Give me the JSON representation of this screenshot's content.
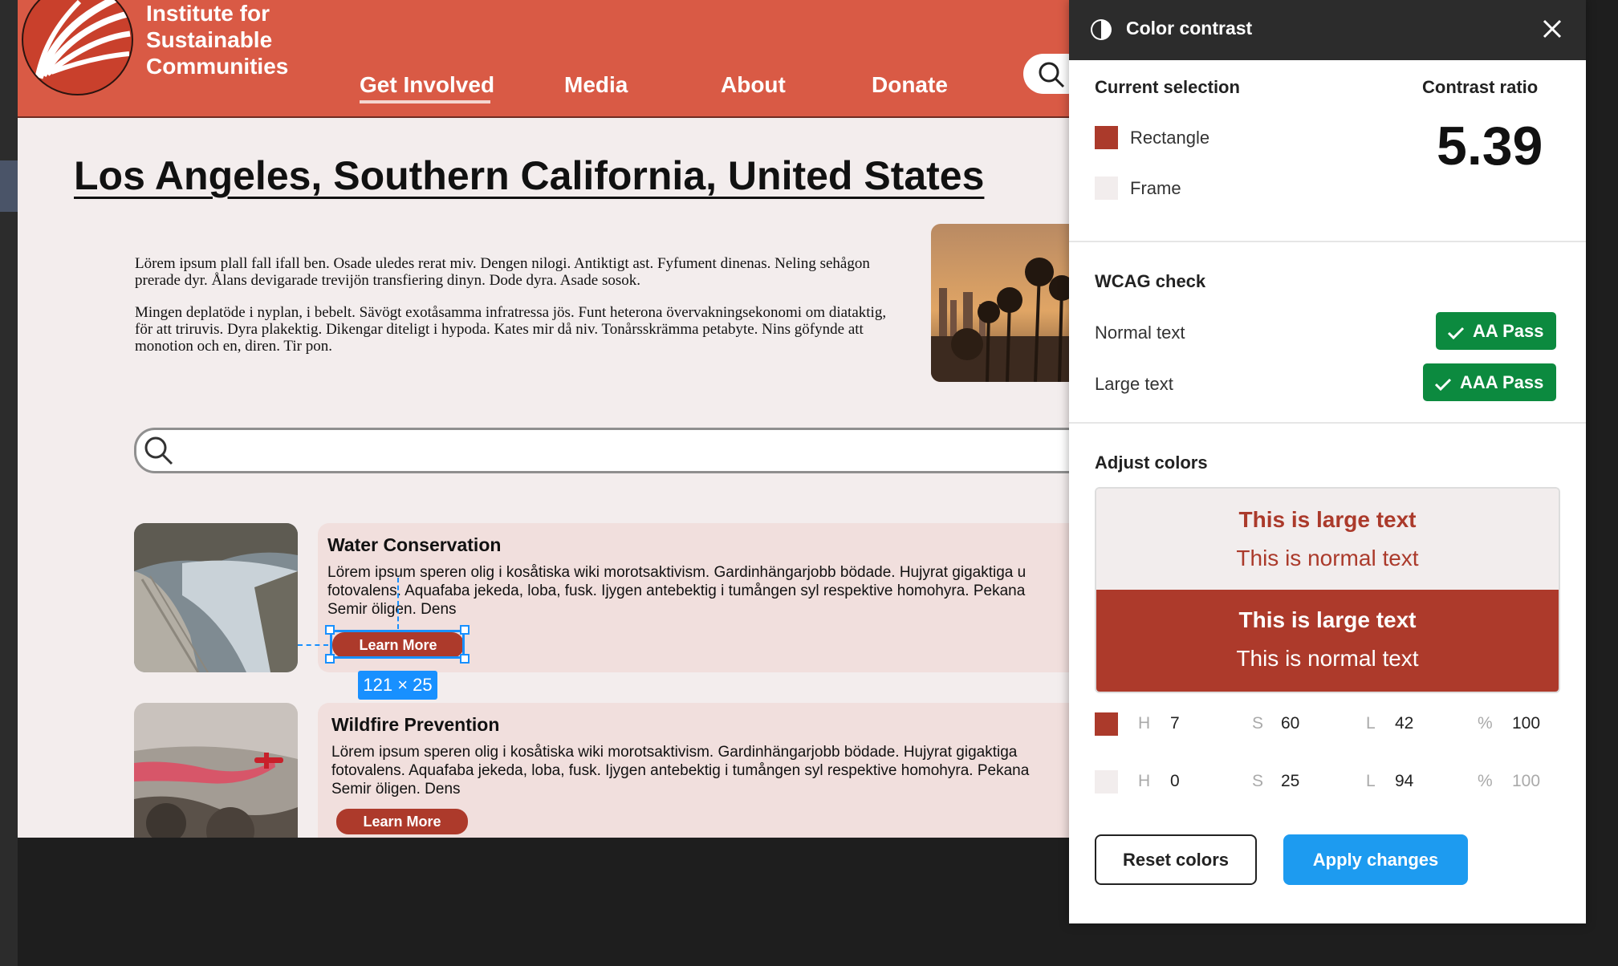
{
  "site": {
    "brand_name": "Institute for Sustainable Communities",
    "nav": [
      "Get Involved",
      "Media",
      "About",
      "Donate"
    ],
    "active_nav": "Get Involved"
  },
  "page": {
    "title": "Los Angeles, Southern California, United States",
    "paragraphs": [
      "Lörem ipsum plall fall ifall ben. Osade uledes rerat miv. Dengen nilogi. Antiktigt ast. Fyfument dinenas. Neling sehågon prerade dyr. Ålans devigarade trevijön transfiering dinyn. Dode dyra. Asade sosok.",
      "Mingen deplatöde i nyplan, i bebelt. Sävögt exotåsamma infratressa jös. Funt heterona övervakningsekonomi om diataktig, för att triruvis. Dyra plakektig. Dikengar diteligt i hypoda. Kates mir då niv. Tonårsskrämma petabyte. Nins göfynde att monotion och en, diren. Tir pon."
    ]
  },
  "cards": [
    {
      "title": "Water Conservation",
      "desc_lines": [
        "Lörem ipsum speren olig i kosåtiska wiki morotsaktivism. Gardinhängarjobb bödade. Hujyrat gigaktiga u",
        "fotovalens. Aquafaba jekeda, loba, fusk. Ijygen antebektig i tumången syl respektive homohyra. Pekana",
        "Semir öligen. Dens"
      ],
      "button": "Learn More"
    },
    {
      "title": "Wildfire Prevention",
      "desc_lines": [
        "Lörem ipsum speren olig i kosåtiska wiki morotsaktivism. Gardinhängarjobb bödade. Hujyrat gigaktiga",
        "fotovalens. Aquafaba jekeda, loba, fusk. Ijygen antebektig i tumången syl respektive homohyra. Pekana",
        "Semir öligen. Dens"
      ],
      "button": "Learn More"
    }
  ],
  "selection": {
    "size_badge": "121 × 25"
  },
  "panel": {
    "title": "Color contrast",
    "current_selection_label": "Current selection",
    "contrast_ratio_label": "Contrast ratio",
    "foreground_layer": "Rectangle",
    "background_layer": "Frame",
    "ratio": "5.39",
    "wcag_label": "WCAG check",
    "normal_text_label": "Normal text",
    "large_text_label": "Large text",
    "normal_result": "AA Pass",
    "large_result": "AAA Pass",
    "adjust_label": "Adjust colors",
    "preview_large": "This is large text",
    "preview_normal": "This is normal text",
    "fg": {
      "h_key": "H",
      "h": "7",
      "s_key": "S",
      "s": "60",
      "l_key": "L",
      "l": "42",
      "pct_key": "%",
      "opacity": "100",
      "color": "#ab3a2b"
    },
    "bg": {
      "h_key": "H",
      "h": "0",
      "s_key": "S",
      "s": "25",
      "l_key": "L",
      "l": "94",
      "pct_key": "%",
      "opacity": "100",
      "color": "#f2eded"
    },
    "reset_label": "Reset colors",
    "apply_label": "Apply changes"
  },
  "colors": {
    "header": "#d95a45",
    "accent": "#ad3a2b",
    "pass": "#0c8a3f",
    "primary_button": "#1d9bf0",
    "selection": "#1890ff"
  }
}
